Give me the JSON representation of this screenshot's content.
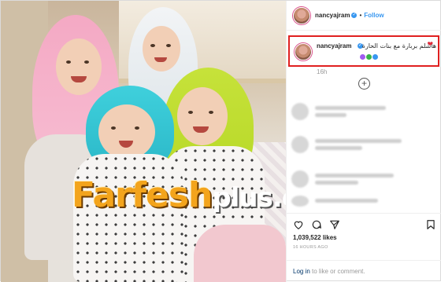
{
  "header": {
    "username": "nancyajram",
    "follow_label": "Follow"
  },
  "caption": {
    "username": "nancyajram",
    "text": "هاشلم بربارة مع بنات الحارة",
    "heart_colors": [
      "#a15cf0",
      "#37b34a",
      "#3897f0"
    ]
  },
  "time_ago": "16h",
  "likes": "1,039,522 likes",
  "posted": "16 HOURS AGO",
  "footer": {
    "login_label": "Log in",
    "rest": " to like or comment."
  },
  "watermark": {
    "main": "Farfesh",
    "plus": "plus.com"
  },
  "colors": {
    "accent": "#3897f0",
    "highlight_border": "#e02020"
  }
}
